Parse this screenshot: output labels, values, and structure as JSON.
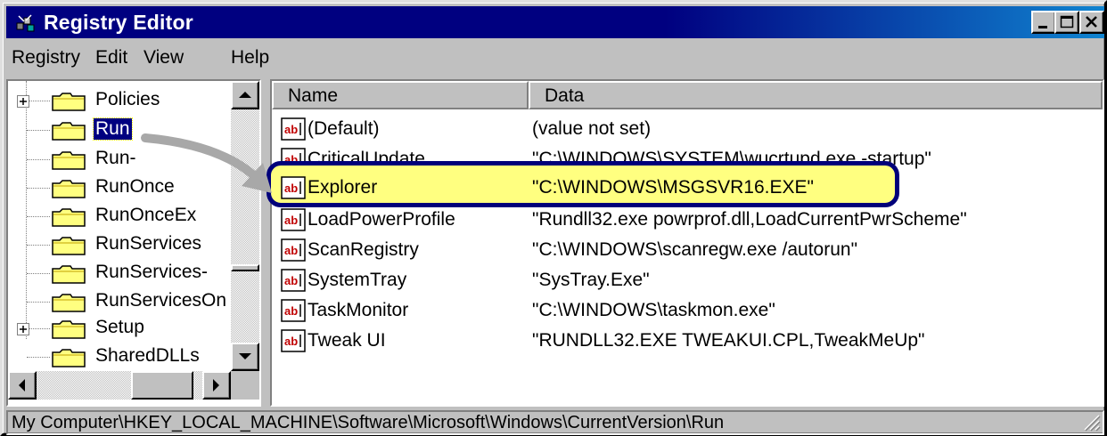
{
  "window": {
    "title": "Registry Editor"
  },
  "menu": [
    "Registry",
    "Edit",
    "View",
    "Help"
  ],
  "tree": {
    "items": [
      {
        "label": "Policies",
        "expandable": true,
        "selected": false
      },
      {
        "label": "Run",
        "expandable": false,
        "selected": true
      },
      {
        "label": "Run-",
        "expandable": false,
        "selected": false
      },
      {
        "label": "RunOnce",
        "expandable": false,
        "selected": false
      },
      {
        "label": "RunOnceEx",
        "expandable": false,
        "selected": false
      },
      {
        "label": "RunServices",
        "expandable": false,
        "selected": false
      },
      {
        "label": "RunServices-",
        "expandable": false,
        "selected": false
      },
      {
        "label": "RunServicesOn",
        "expandable": false,
        "selected": false
      },
      {
        "label": "Setup",
        "expandable": true,
        "selected": false
      },
      {
        "label": "SharedDLLs",
        "expandable": false,
        "selected": false
      }
    ]
  },
  "list": {
    "columns": [
      "Name",
      "Data"
    ],
    "rows": [
      {
        "name": "(Default)",
        "data": "(value not set)"
      },
      {
        "name": "CriticalUpdate",
        "data": "\"C:\\WINDOWS\\SYSTEM\\wucrtupd.exe -startup\""
      },
      {
        "name": "Explorer",
        "data": "\"C:\\WINDOWS\\MSGSVR16.EXE\"",
        "highlighted": true
      },
      {
        "name": "LoadPowerProfile",
        "data": "\"Rundll32.exe powrprof.dll,LoadCurrentPwrScheme\""
      },
      {
        "name": "ScanRegistry",
        "data": "\"C:\\WINDOWS\\scanregw.exe /autorun\""
      },
      {
        "name": "SystemTray",
        "data": "\"SysTray.Exe\""
      },
      {
        "name": "TaskMonitor",
        "data": "\"C:\\WINDOWS\\taskmon.exe\""
      },
      {
        "name": "Tweak UI",
        "data": "\"RUNDLL32.EXE TWEAKUI.CPL,TweakMeUp\""
      }
    ]
  },
  "status": {
    "path": "My Computer\\HKEY_LOCAL_MACHINE\\Software\\Microsoft\\Windows\\CurrentVersion\\Run"
  },
  "colors": {
    "titlebar": "#000080",
    "highlight": "#ffff80",
    "highlight_border": "#00007a",
    "selection": "#000080"
  },
  "icons": {
    "app": "registry-editor-icon",
    "folder": "folder-icon",
    "value": "string-value-icon"
  }
}
